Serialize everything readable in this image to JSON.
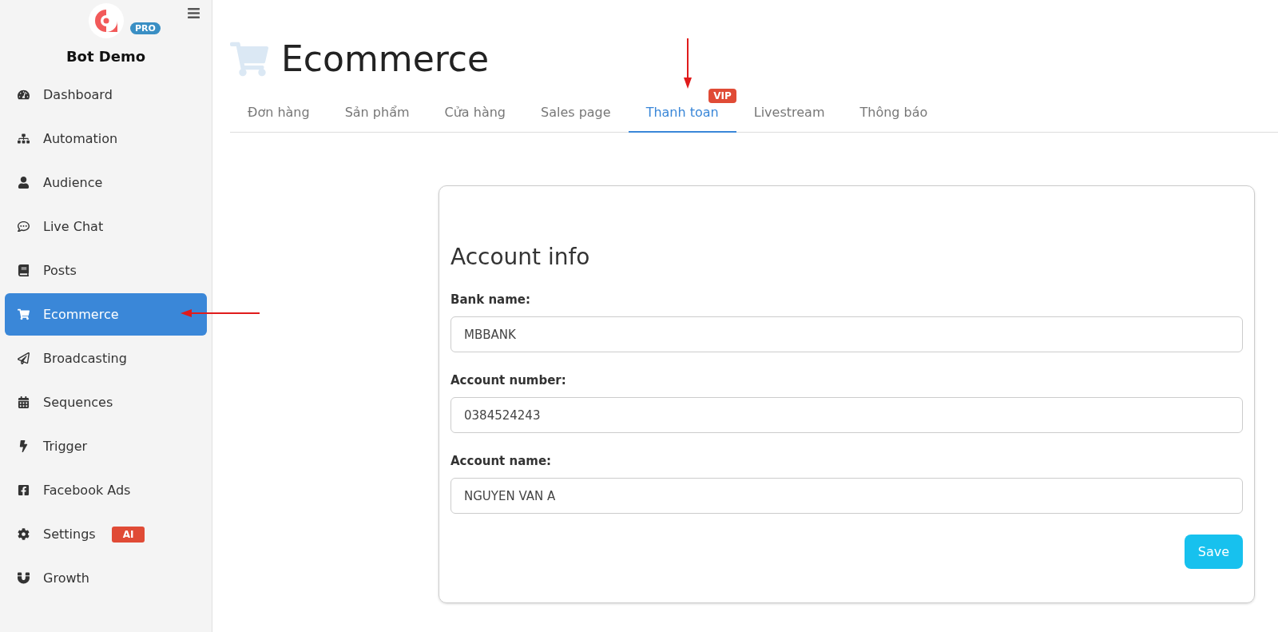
{
  "brand": {
    "name": "Bot Demo",
    "plan": "PRO"
  },
  "sidebar": {
    "items": [
      {
        "label": "Dashboard",
        "selected": false
      },
      {
        "label": "Automation",
        "selected": false
      },
      {
        "label": "Audience",
        "selected": false
      },
      {
        "label": "Live Chat",
        "selected": false
      },
      {
        "label": "Posts",
        "selected": false
      },
      {
        "label": "Ecommerce",
        "selected": true
      },
      {
        "label": "Broadcasting",
        "selected": false
      },
      {
        "label": "Sequences",
        "selected": false
      },
      {
        "label": "Trigger",
        "selected": false
      },
      {
        "label": "Facebook Ads",
        "selected": false
      },
      {
        "label": "Settings",
        "selected": false,
        "badge": "AI"
      },
      {
        "label": "Growth",
        "selected": false
      }
    ]
  },
  "page": {
    "title": "Ecommerce"
  },
  "tabs": [
    {
      "label": "Đơn hàng",
      "selected": false
    },
    {
      "label": "Sản phẩm",
      "selected": false
    },
    {
      "label": "Cửa hàng",
      "selected": false
    },
    {
      "label": "Sales page",
      "selected": false
    },
    {
      "label": "Thanh toan",
      "selected": true,
      "badge": "VIP"
    },
    {
      "label": "Livestream",
      "selected": false
    },
    {
      "label": "Thông báo",
      "selected": false
    }
  ],
  "form": {
    "title": "Account info",
    "fields": [
      {
        "label": "Bank name:",
        "value": "MBBANK"
      },
      {
        "label": "Account number:",
        "value": "0384524243"
      },
      {
        "label": "Account name:",
        "value": "NGUYEN VAN A"
      }
    ],
    "button": "Save"
  }
}
